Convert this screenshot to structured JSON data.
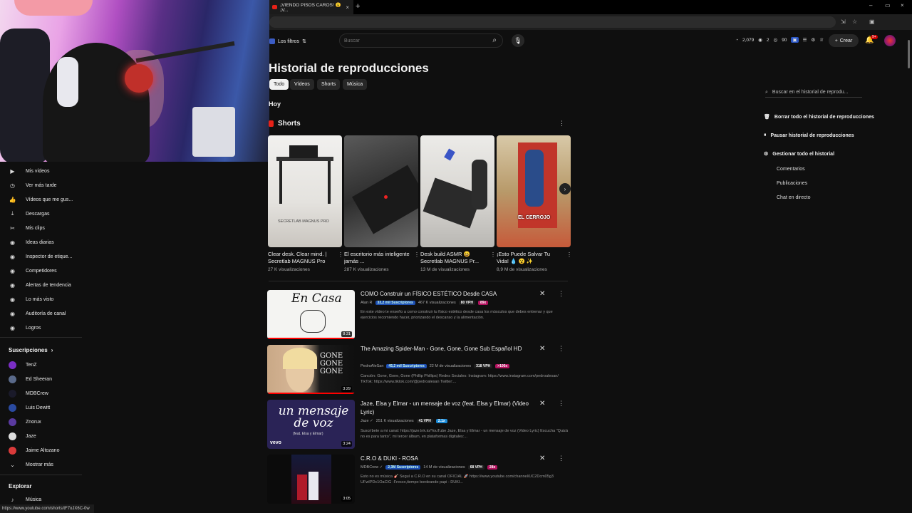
{
  "browser": {
    "tab_title": "¡VIENDO PISOS CAROS! 😮 ¡V...",
    "tab_close": "×",
    "new_tab": "+",
    "window_controls": [
      "–",
      "▭",
      "×"
    ],
    "toolbar_icons": [
      "⇲",
      "☆",
      "▣"
    ]
  },
  "status_url": "https://www.youtube.com/shorts/tF7oJX6C-0w",
  "sidebar": {
    "items": [
      {
        "label": "Mis vídeos",
        "icon": "▶"
      },
      {
        "label": "Ver más tarde",
        "icon": "◷"
      },
      {
        "label": "Vídeos que me gus...",
        "icon": "👍"
      },
      {
        "label": "Descargas",
        "icon": "⤓"
      },
      {
        "label": "Mis clips",
        "icon": "✂"
      },
      {
        "label": "Ideas diarias",
        "icon": "◉"
      },
      {
        "label": "Inspector de etique...",
        "icon": "◉"
      },
      {
        "label": "Competidores",
        "icon": "◉"
      },
      {
        "label": "Alertas de tendencia",
        "icon": "◉"
      },
      {
        "label": "Lo más visto",
        "icon": "◉"
      },
      {
        "label": "Auditoría de canal",
        "icon": "◉"
      },
      {
        "label": "Logros",
        "icon": "◉"
      }
    ],
    "subs_title": "Suscripciones",
    "subs_chevron": "›",
    "subscriptions": [
      {
        "label": "TenZ",
        "color": "#7a2ec4"
      },
      {
        "label": "Ed Sheeran",
        "color": "#5a6a8a"
      },
      {
        "label": "MDBCrew",
        "color": "#1a1a2a"
      },
      {
        "label": "Luis Dewitt",
        "color": "#2a4aa0"
      },
      {
        "label": "Znorux",
        "color": "#5a3aa0"
      },
      {
        "label": "Jaze",
        "color": "#ddd"
      },
      {
        "label": "Jaime Altozano",
        "color": "#d93a3a"
      }
    ],
    "more_label": "Mostrar más",
    "explore_title": "Explorar",
    "music_label": "Música"
  },
  "header": {
    "filters_label": "Los filtros",
    "search_placeholder": "Buscar",
    "stats": [
      "2,079",
      "2",
      "90"
    ],
    "create_label": "Crear",
    "bell_badge": "9+"
  },
  "main": {
    "title": "Historial de reproducciones",
    "chips": [
      "Todo",
      "Vídeos",
      "Shorts",
      "Música"
    ],
    "today": "Hoy",
    "shorts_heading": "Shorts",
    "shorts": [
      {
        "title": "Clear desk. Clear mind. | Secretlab MAGNUS Pro",
        "views": "27 K visualizaciones",
        "overlay": "SECRETLAB MAGNUS PRO"
      },
      {
        "title": "El escritorio más inteligente jamás ...",
        "views": "287 K visualizaciones",
        "overlay": ""
      },
      {
        "title": "Desk build ASMR 😀 Secretlab MAGNUS Pr...",
        "views": "13 M de visualizaciones",
        "overlay": ""
      },
      {
        "title": "¡Esto Puede Salvar Tu Vida! 💧 😮 ✨",
        "views": "8,9 M de visualizaciones",
        "overlay": "EL CERROJO"
      }
    ],
    "videos": [
      {
        "title": "COMO Construir un FÍSICO ESTÉTICO Desde CASA",
        "channel": "Alan R",
        "subs": "33,2 mil Suscriptores",
        "views": "467 K visualizaciones",
        "vph": "80 VPH",
        "mult": "89x",
        "duration": "8:31",
        "thumb_text": "En Casa",
        "desc": "En este vídeo te enseño a como construir tu físico estético desde casa los músculos que debes entrenar y que ejercicios recomiendo hacer, priorizando el descanso y la alimentación."
      },
      {
        "title": "The Amazing Spider-Man - Gone, Gone, Gone Sub Español HD",
        "channel": "PedroAleSan",
        "subs": "45,2 mil Suscriptores",
        "views": "22 M de visualizaciones",
        "vph": "318 VPH",
        "mult": ">100x",
        "duration": "3:29",
        "thumb_text": "GONE GONE GONE",
        "desc": "Canción: Gone, Gone, Gone (Phillip Phillips) Redes Sociales: Instagram: https://www.instagram.com/pedroalesan/ TikTok: https://www.tiktok.com/@pedroalesan Twitter:..."
      },
      {
        "title": "Jaze, Elsa y Elmar - un mensaje de voz (feat. Elsa y Elmar) (Video Lyric)",
        "channel": "Jaze ✓",
        "subs": "",
        "views": "251 K visualizaciones",
        "vph": "41 VPH",
        "mult": "2.1x",
        "duration": "3:24",
        "thumb_text": "un mensaje de voz",
        "thumb_sub": "(feat. Elsa y Elmar)",
        "thumb_logo": "vevo",
        "desc": "Suscríbete a mi canal: https://jaze.lnk.to/YouTube Jaze, Elsa y Elmar - un mensaje de voz (Video Lyric) Escucha \"Quizá no es para tanto\", mi tercer álbum, en plataformas digitales:..."
      },
      {
        "title": "C.R.O & DUKI - ROSA",
        "channel": "MDBCrew ✓",
        "subs": "2,3M Suscriptores",
        "views": "14 M de visualizaciones",
        "vph": "68 VPH",
        "mult": "28x",
        "duration": "3:05",
        "thumb_text": "",
        "desc": "Esto no es música 🎸 Seguí a C.R.O en su canal OFICIAL 🚀 https://www.youtube.com/channel/UC2Dcm05g3 UFwIPDc1OaCIG -Fresco,tiempo bordeando papi - DUKI..."
      }
    ]
  },
  "right_panel": {
    "search_placeholder": "Buscar en el historial de reprodu...",
    "actions": [
      {
        "label": "Borrar todo el historial de reproducciones",
        "icon": "🗑"
      },
      {
        "label": "Pausar historial de reproducciones",
        "icon": "⏸"
      },
      {
        "label": "Gestionar todo el historial",
        "icon": "⚙"
      }
    ],
    "subitems": [
      "Comentarios",
      "Publicaciones",
      "Chat en directo"
    ]
  }
}
